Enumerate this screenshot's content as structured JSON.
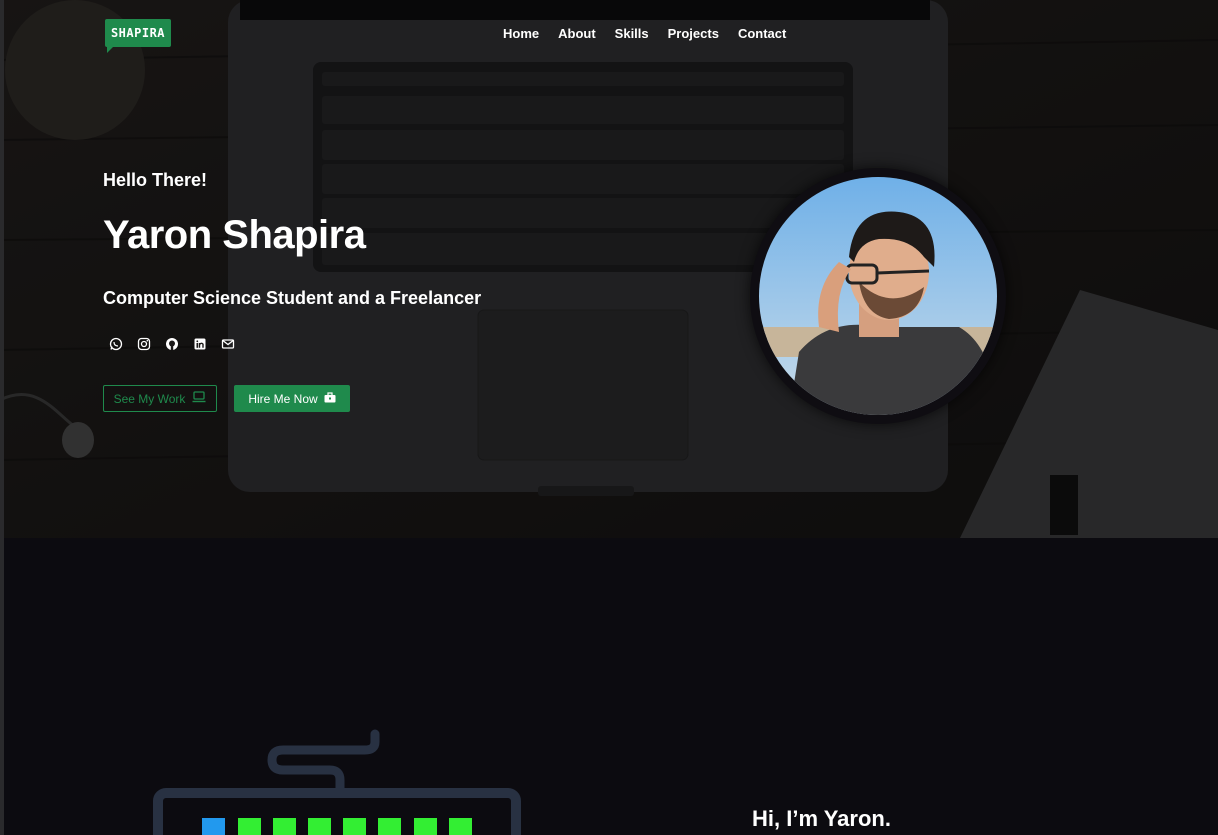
{
  "brand": {
    "logo_text": "SHAPIRA",
    "accent": "#1f8a4c"
  },
  "nav": {
    "items": [
      "Home",
      "About",
      "Skills",
      "Projects",
      "Contact"
    ]
  },
  "hero": {
    "greeting": "Hello There!",
    "name": "Yaron Shapira",
    "role": "Computer Science Student and a Freelancer",
    "social_icons": [
      "whatsapp-icon",
      "instagram-icon",
      "github-icon",
      "linkedin-icon",
      "mail-icon"
    ],
    "see_work_label": "See My Work",
    "hire_label": "Hire Me Now"
  },
  "about": {
    "title": "Hi, I’m Yaron."
  },
  "colors": {
    "background": "#0c0b10",
    "accent_green": "#1f8a4c",
    "key_green": "#33ee33",
    "key_blue": "#2299ee"
  }
}
